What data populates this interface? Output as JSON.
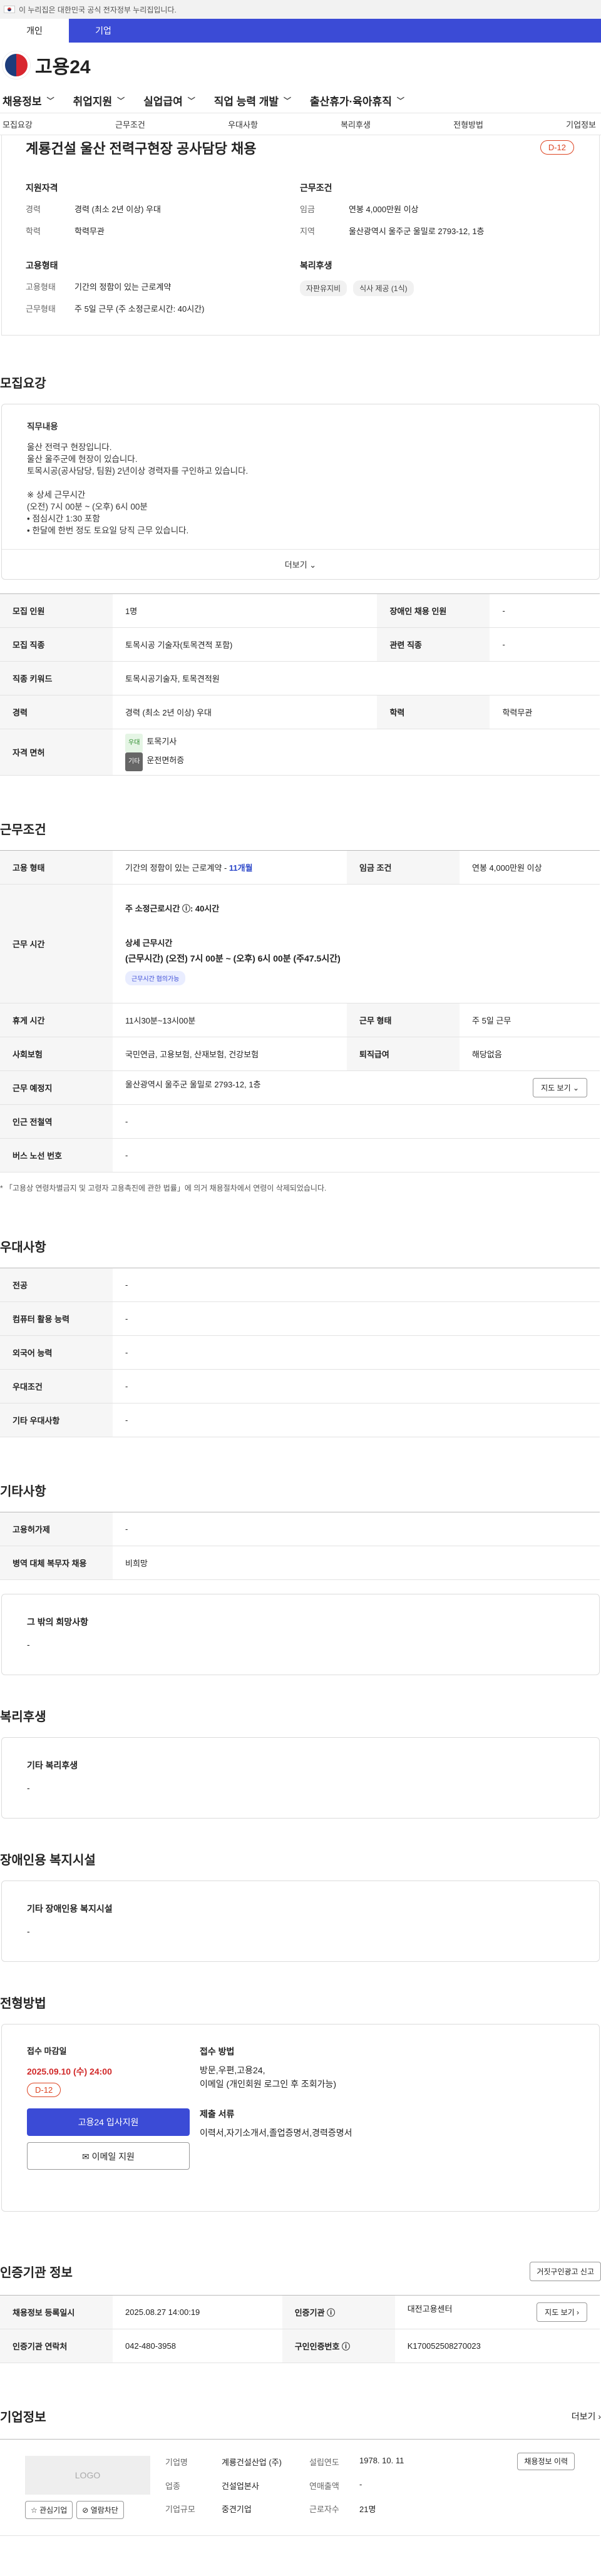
{
  "gov_banner": "이 누리집은 대한민국 공식 전자정부 누리집입니다.",
  "user_tabs": [
    "개인",
    "기업"
  ],
  "logo": "고용24",
  "main_nav": [
    "채용정보",
    "취업지원",
    "실업급여",
    "직업 능력 개발",
    "출산휴가·육아휴직"
  ],
  "anchor_tabs": [
    "모집요강",
    "근무조건",
    "우대사항",
    "복리후생",
    "전형방법",
    "기업정보"
  ],
  "job": {
    "title": "계룡건설 울산 전력구현장 공사담당 채용",
    "dday": "D-12",
    "qual_head": "지원자격",
    "career_k": "경력",
    "career_v": "경력 (최소 2년 이상) 우대",
    "edu_k": "학력",
    "edu_v": "학력무관",
    "cond_head": "근무조건",
    "pay_k": "임금",
    "pay_v": "연봉 4,000만원 이상",
    "region_k": "지역",
    "region_v": "울산광역시 울주군 울밀로 2793-12, 1층",
    "emp_head": "고용형태",
    "etype_k": "고용형태",
    "etype_v": "기간의 정함이 있는 근로계약",
    "wtype_k": "근무형태",
    "wtype_v": "주 5일 근무 (주 소정근로시간: 40시간)",
    "welfare_head": "복리후생",
    "welfare_chips": [
      "자판유지비",
      "식사 제공 (1식)"
    ]
  },
  "recruit": {
    "heading": "모집요강",
    "content_label": "직무내용",
    "content": "울산 전력구 현장입니다.\n울산 울주군에 현장이 있습니다.\n토목시공(공사담당, 팀원) 2년이상 경력자를 구인하고 있습니다.\n\n※ 상세 근무시간\n(오전) 7시 00분 ~ (오후) 6시 00분\n• 점심시간 1:30 포함\n• 한달에 한번 정도 토요일 당직 근무 있습니다.",
    "more": "더보기",
    "rows": [
      {
        "k1": "모집 인원",
        "v1": "1명",
        "k2": "장애인 채용 인원",
        "v2": "-"
      },
      {
        "k1": "모집 직종",
        "v1": "토목시공 기술자(토목견적 포함)",
        "k2": "관련 직종",
        "v2": "-"
      },
      {
        "k1": "직종 키워드",
        "v1": "토목시공기술자, 토목견적원"
      },
      {
        "k1": "경력",
        "v1": "경력 (최소 2년 이상) 우대",
        "k2": "학력",
        "v2": "학력무관"
      }
    ],
    "license_k": "자격 면허",
    "licenses": [
      {
        "tag": "우대",
        "name": "토목기사"
      },
      {
        "tag": "기타",
        "name": "운전면허증"
      }
    ]
  },
  "work": {
    "heading": "근무조건",
    "etype_k": "고용 형태",
    "etype_v": "기간의 정함이 있는 근로계약 - ",
    "etype_months": "11개월",
    "pay_k": "임금 조건",
    "pay_v": "연봉 4,000만원 이상",
    "hours_k": "근무 시간",
    "hours_total": "주 소정근로시간 ⓘ: 40시간",
    "hours_detail_label": "상세 근무시간",
    "hours_detail": "(근무시간) (오전) 7시 00분 ~ (오후) 6시 00분 (주47.5시간)",
    "hours_tag": "근무시간 협의가능",
    "break_k": "휴게 시간",
    "break_v": "11시30분~13시00분",
    "wtype_k": "근무 형태",
    "wtype_v": "주 5일 근무",
    "ins_k": "사회보험",
    "ins_v": "국민연금, 고용보험, 산재보험, 건강보험",
    "retire_k": "퇴직급여",
    "retire_v": "해당없음",
    "place_k": "근무 예정지",
    "place_v": "울산광역시 울주군 울밀로 2793-12, 1층",
    "map_btn": "지도 보기 ⌄",
    "subway_k": "인근 전철역",
    "subway_v": "-",
    "bus_k": "버스 노선 번호",
    "bus_v": "-",
    "note": "* 「고용상 연령차별금지 및 고령자 고용촉진에 관한 법률」에 의거 채용절차에서 연령이 삭제되었습니다."
  },
  "pref": {
    "heading": "우대사항",
    "rows": [
      {
        "k": "전공",
        "v": "-"
      },
      {
        "k": "컴퓨터 활용 능력",
        "v": "-"
      },
      {
        "k": "외국어 능력",
        "v": "-"
      },
      {
        "k": "우대조건",
        "v": "-"
      },
      {
        "k": "기타 우대사항",
        "v": "-"
      }
    ]
  },
  "etc": {
    "heading": "기타사항",
    "rows": [
      {
        "k": "고용허가제",
        "v": "-"
      },
      {
        "k": "병역 대체 복무자 채용",
        "v": "비희망"
      }
    ],
    "other_label": "그 밖의 희망사항",
    "other_v": "-"
  },
  "welfare": {
    "heading": "복리후생",
    "label": "기타 복리후생",
    "v": "-"
  },
  "disabled": {
    "heading": "장애인용 복지시설",
    "label": "기타 장애인용 복지시설",
    "v": "-"
  },
  "apply": {
    "heading": "전형방법",
    "deadline_label": "접수 마감일",
    "deadline": "2025.09.10 (수) 24:00",
    "dday": "D-12",
    "btn_apply": "고용24 입사지원",
    "btn_email": "✉ 이메일 지원",
    "method_label": "접수 방법",
    "method_v": "방문,우편,고용24,\n이메일 (개인회원 로그인 후 조회가능)",
    "docs_label": "제출 서류",
    "docs_v": "이력서,자기소개서,졸업증명서,경력증명서"
  },
  "cert": {
    "heading": "인증기관 정보",
    "report_btn": "거짓구인광고 신고",
    "reg_k": "채용정보 등록일시",
    "reg_v": "2025.08.27 14:00:19",
    "org_k": "인증기관 ⓘ",
    "org_v": "대전고용센터",
    "map_btn": "지도 보기 ›",
    "tel_k": "인증기관 연락처",
    "tel_v": "042-480-3958",
    "no_k": "구인인증번호 ⓘ",
    "no_v": "K170052508270023"
  },
  "company": {
    "heading": "기업정보",
    "more": "더보기 ›",
    "logo": "LOGO",
    "btn_fav": "☆ 관심기업",
    "btn_block": "⊘ 열람차단",
    "name_k": "기업명",
    "name_v": "계룡건설산업 (주)",
    "found_k": "설립연도",
    "found_v": "1978. 10. 11",
    "sales_k": "연매출액",
    "sales_v": "-",
    "ind_k": "업종",
    "ind_v": "건설업본사",
    "emp_k": "근로자수",
    "emp_v": "21명",
    "size_k": "기업규모",
    "size_v": "중견기업",
    "job_btn": "채용정보 이력"
  }
}
